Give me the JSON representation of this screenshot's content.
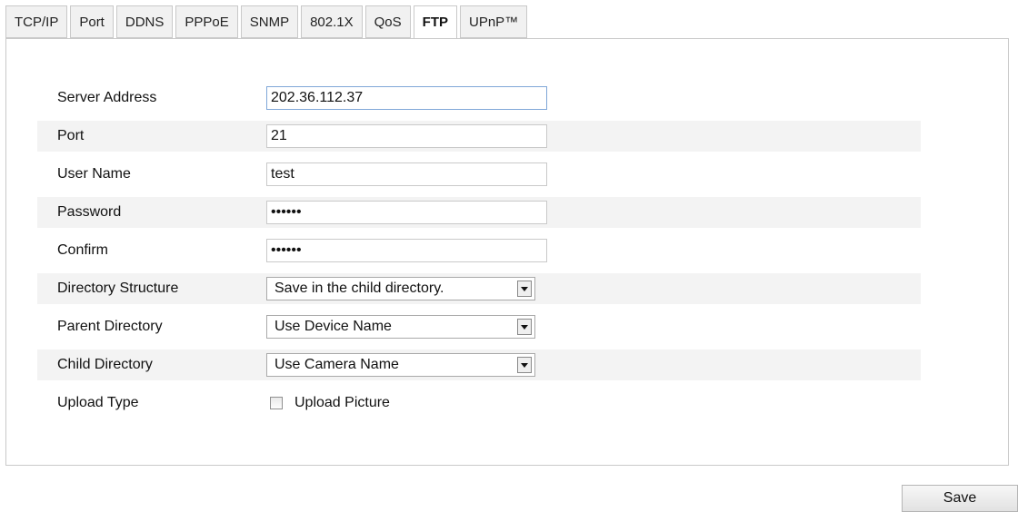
{
  "tabs": [
    {
      "label": "TCP/IP",
      "active": false
    },
    {
      "label": "Port",
      "active": false
    },
    {
      "label": "DDNS",
      "active": false
    },
    {
      "label": "PPPoE",
      "active": false
    },
    {
      "label": "SNMP",
      "active": false
    },
    {
      "label": "802.1X",
      "active": false
    },
    {
      "label": "QoS",
      "active": false
    },
    {
      "label": "FTP",
      "active": true
    },
    {
      "label": "UPnP™",
      "active": false
    }
  ],
  "form": {
    "server_address": {
      "label": "Server Address",
      "value": "202.36.112.37"
    },
    "port": {
      "label": "Port",
      "value": "21"
    },
    "user_name": {
      "label": "User Name",
      "value": "test"
    },
    "password": {
      "label": "Password",
      "value": "••••••"
    },
    "confirm": {
      "label": "Confirm",
      "value": "••••••"
    },
    "directory_structure": {
      "label": "Directory Structure",
      "value": "Save in the child directory."
    },
    "parent_directory": {
      "label": "Parent Directory",
      "value": "Use Device Name"
    },
    "child_directory": {
      "label": "Child Directory",
      "value": "Use Camera Name"
    },
    "upload_type": {
      "label": "Upload Type",
      "checkbox_label": "Upload Picture",
      "checked": false
    }
  },
  "actions": {
    "save_label": "Save"
  },
  "icons": {
    "dropdown": "chevron-down-icon"
  },
  "colors": {
    "row_shade": "#f3f3f3",
    "focused_border": "#7fa7d8",
    "border": "#c9c9c9"
  }
}
